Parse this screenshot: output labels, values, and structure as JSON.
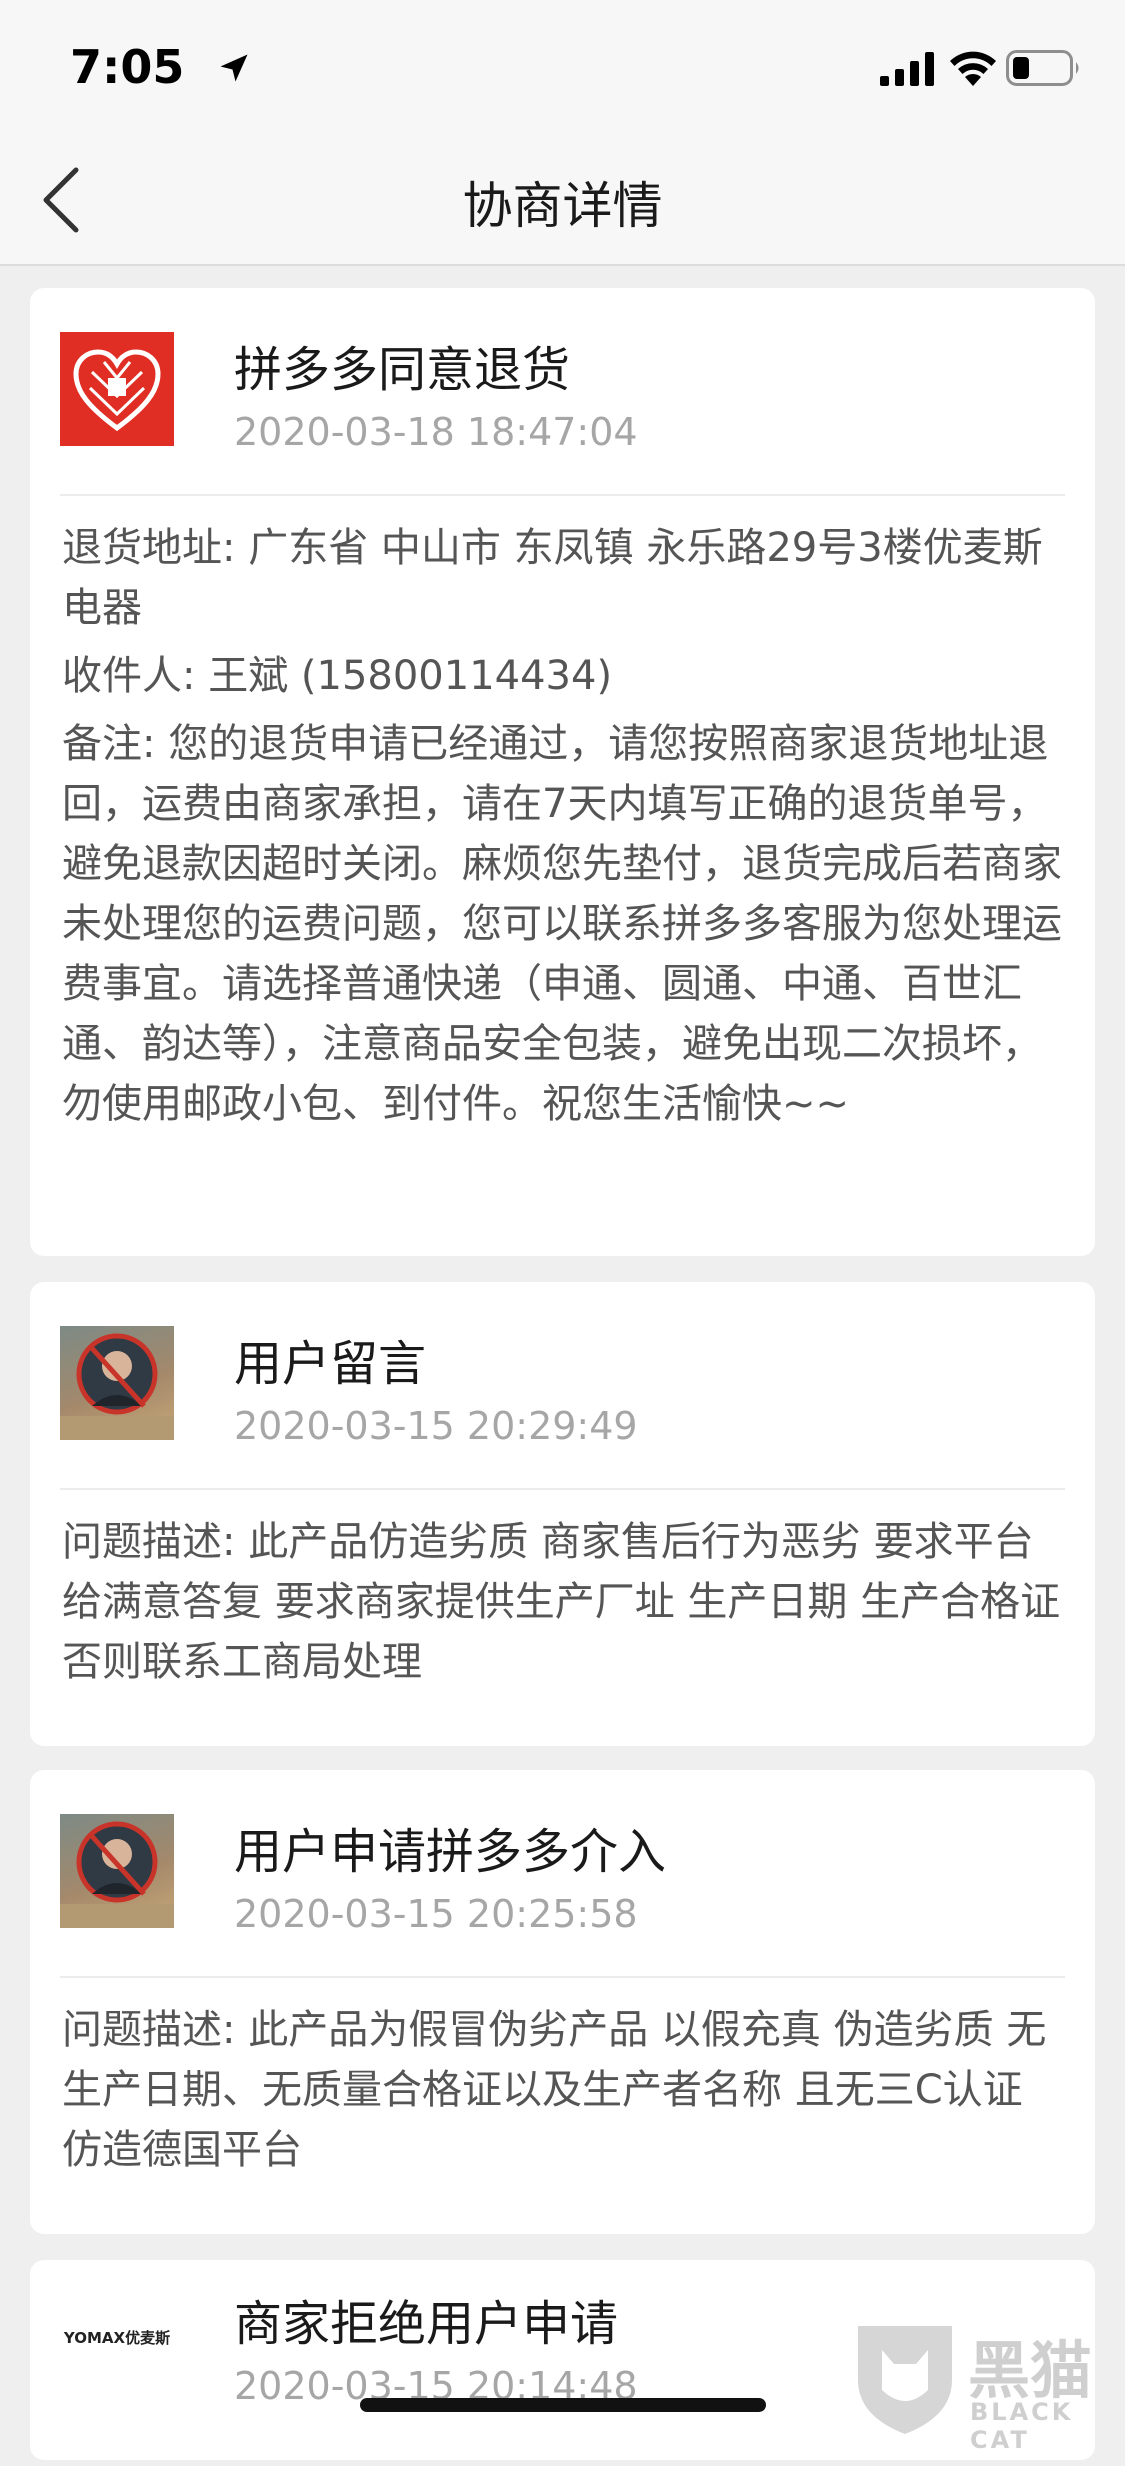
{
  "status_bar": {
    "time": "7:05"
  },
  "nav": {
    "title": "协商详情"
  },
  "cards": [
    {
      "title": "拼多多同意退货",
      "time": "2020-03-18 18:47:04",
      "address": "退货地址: 广东省 中山市 东凤镇 永乐路29号3楼优麦斯电器",
      "recipient": "收件人: 王斌 (15800114434)",
      "note": "备注: 您的退货申请已经通过，请您按照商家退货地址退回，运费由商家承担，请在7天内填写正确的退货单号，避免退款因超时关闭。麻烦您先垫付，退货完成后若商家未处理您的运费问题，您可以联系拼多多客服为您处理运费事宜。请选择普通快递（申通、圆通、中通、百世汇通、韵达等），注意商品安全包装，避免出现二次损坏，勿使用邮政小包、到付件。祝您生活愉快~~"
    },
    {
      "title": "用户留言",
      "time": "2020-03-15 20:29:49",
      "description": "问题描述: 此产品仿造劣质 商家售后行为恶劣 要求平台给满意答复 要求商家提供生产厂址 生产日期 生产合格证 否则联系工商局处理"
    },
    {
      "title": "用户申请拼多多介入",
      "time": "2020-03-15 20:25:58",
      "description": "问题描述: 此产品为假冒伪劣产品 以假充真 伪造劣质 无生产日期、无质量合格证以及生产者名称 且无三C认证 仿造德国平台"
    },
    {
      "title": "商家拒绝用户申请",
      "time": "2020-03-15 20:14:48",
      "logo_text": "YOMAX优麦斯"
    }
  ],
  "watermark": {
    "text": "黑猫",
    "sub": "BLACK CAT"
  },
  "colors": {
    "brand_red": "#e02e24",
    "background": "#efefef",
    "muted_text": "#a6a6a6"
  }
}
